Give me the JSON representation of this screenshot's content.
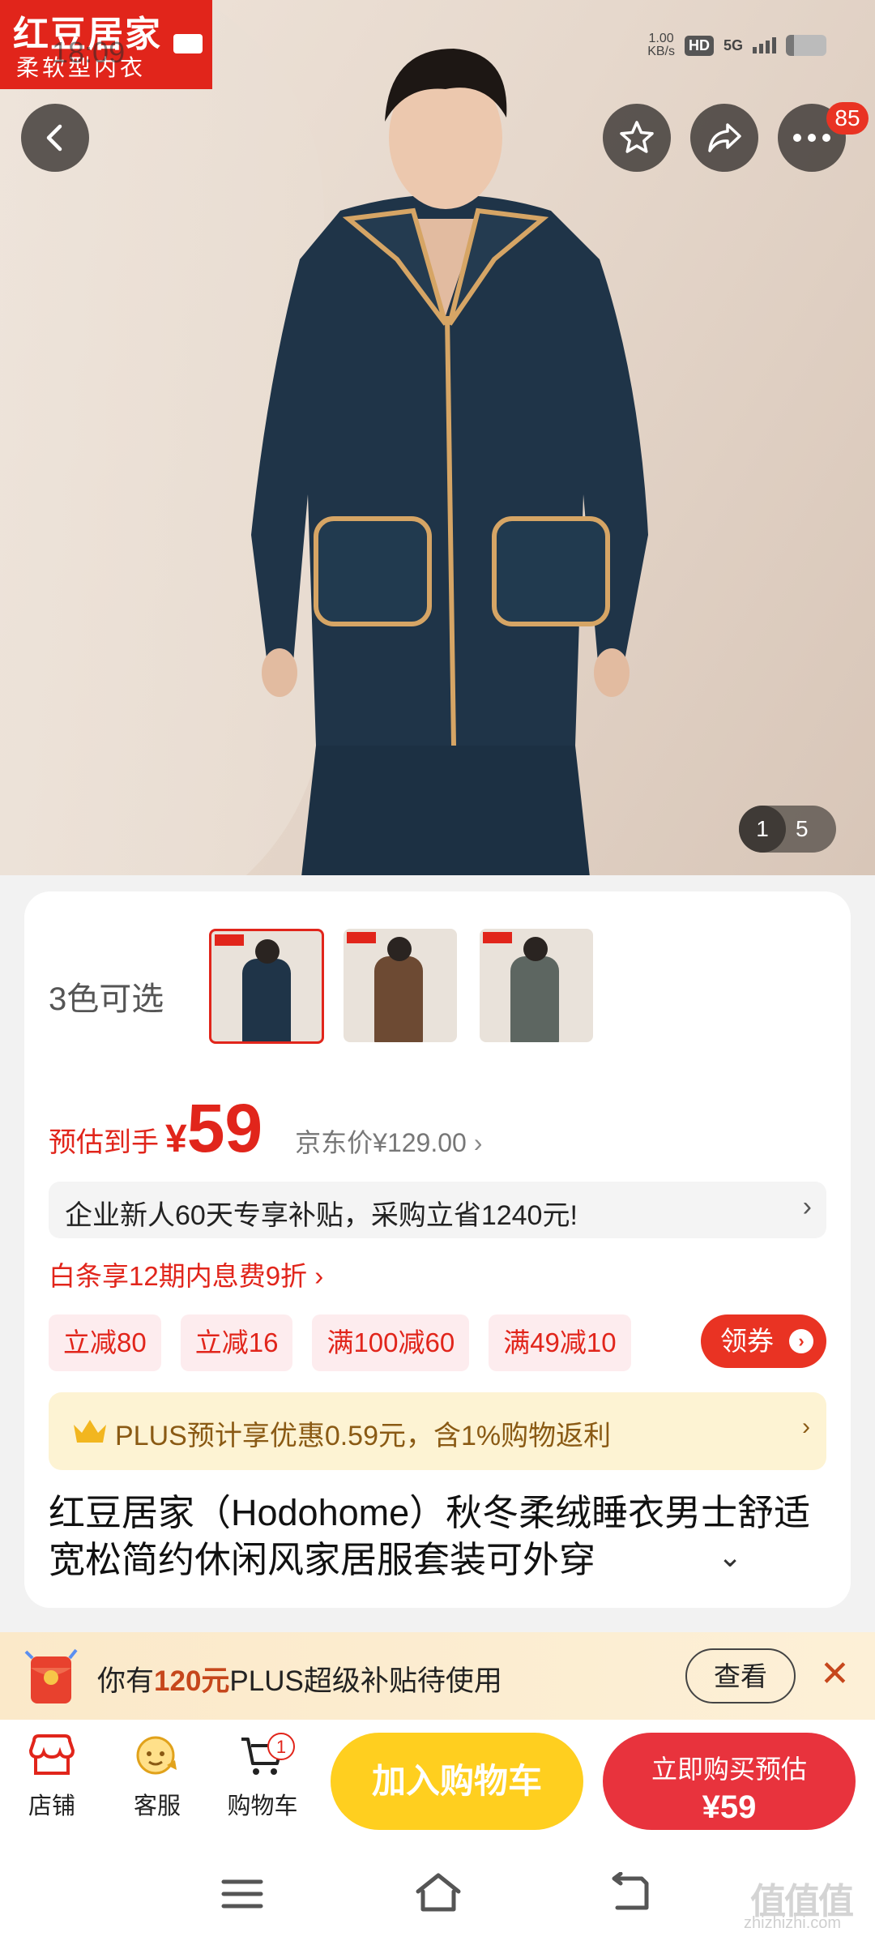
{
  "status_bar": {
    "time": "18:09",
    "net_speed": "1.00",
    "net_unit": "KB/s",
    "hd": "HD",
    "network": "5G"
  },
  "brand_badge": {
    "name": "红豆居家",
    "subtitle": "柔软型内衣"
  },
  "top_actions": {
    "more_badge": "85"
  },
  "gallery": {
    "current": "1",
    "total": "5"
  },
  "product": {
    "colors_label": "3色可选",
    "price_label": "预估到手",
    "currency": "¥",
    "price": "59",
    "jd_price": "京东价¥129.00",
    "subsidy_text": "企业新人60天专享补贴，采购立省1240元!",
    "baitiao_text": "白条享12期内息费9折",
    "coupons": [
      "立减80",
      "立减16",
      "满100减60",
      "满49减10"
    ],
    "coupon_button": "领券",
    "plus_text": "PLUS预计享优惠0.59元，含1%购物返利",
    "title": "红豆居家（Hodohome）秋冬柔绒睡衣男士舒适宽松简约休闲风家居服套装可外穿"
  },
  "plus_promo": {
    "pre": "你有",
    "amount": "120元",
    "post": "PLUS超级补贴待使用",
    "view_button": "查看"
  },
  "bottom_bar": {
    "shop_label": "店铺",
    "service_label": "客服",
    "cart_label": "购物车",
    "cart_count": "1",
    "add_to_cart": "加入购物车",
    "buy_now_line1": "立即购买预估",
    "buy_now_line2": "¥59"
  },
  "watermark": {
    "text": "值值值",
    "url": "zhizhizhi.com"
  },
  "colors": {
    "brand_red": "#e1251b",
    "add_cart_yellow": "#ffcf1f",
    "buy_red": "#e8333d",
    "plus_gold": "#8a5a14"
  }
}
